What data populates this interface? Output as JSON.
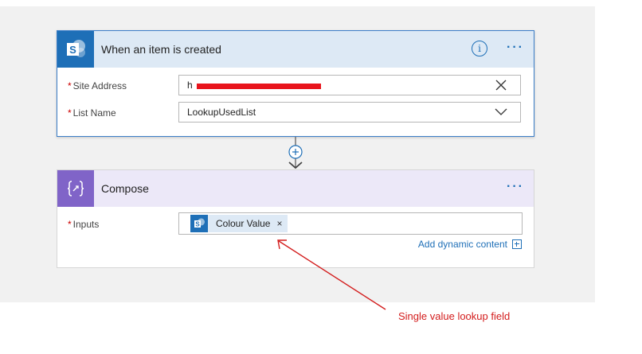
{
  "trigger": {
    "title": "When an item is created",
    "more_label": "···",
    "info_label": "i",
    "fields": [
      {
        "required_mark": "*",
        "label": "Site Address",
        "value": "h"
      },
      {
        "required_mark": "*",
        "label": "List Name",
        "value": "LookupUsedList"
      }
    ]
  },
  "compose": {
    "title": "Compose",
    "more_label": "···",
    "inputs": {
      "required_mark": "*",
      "label": "Inputs",
      "token_label": "Colour Value",
      "token_remove": "×"
    },
    "add_dynamic_content": "Add dynamic content"
  },
  "annotation": {
    "text": "Single value lookup field",
    "color": "#d31c1c"
  },
  "colors": {
    "sharepoint_blue": "#1e6fb7",
    "compose_purple": "#8064c8",
    "trigger_header": "#dde9f5",
    "compose_header": "#ece8f8",
    "redaction": "#e8141c"
  },
  "icons": {
    "trigger": "sharepoint-icon",
    "compose": "compose-braces-icon",
    "token": "sharepoint-icon",
    "clear": "close-icon",
    "dropdown": "chevron-down-icon",
    "connector": "add-step-icon"
  }
}
